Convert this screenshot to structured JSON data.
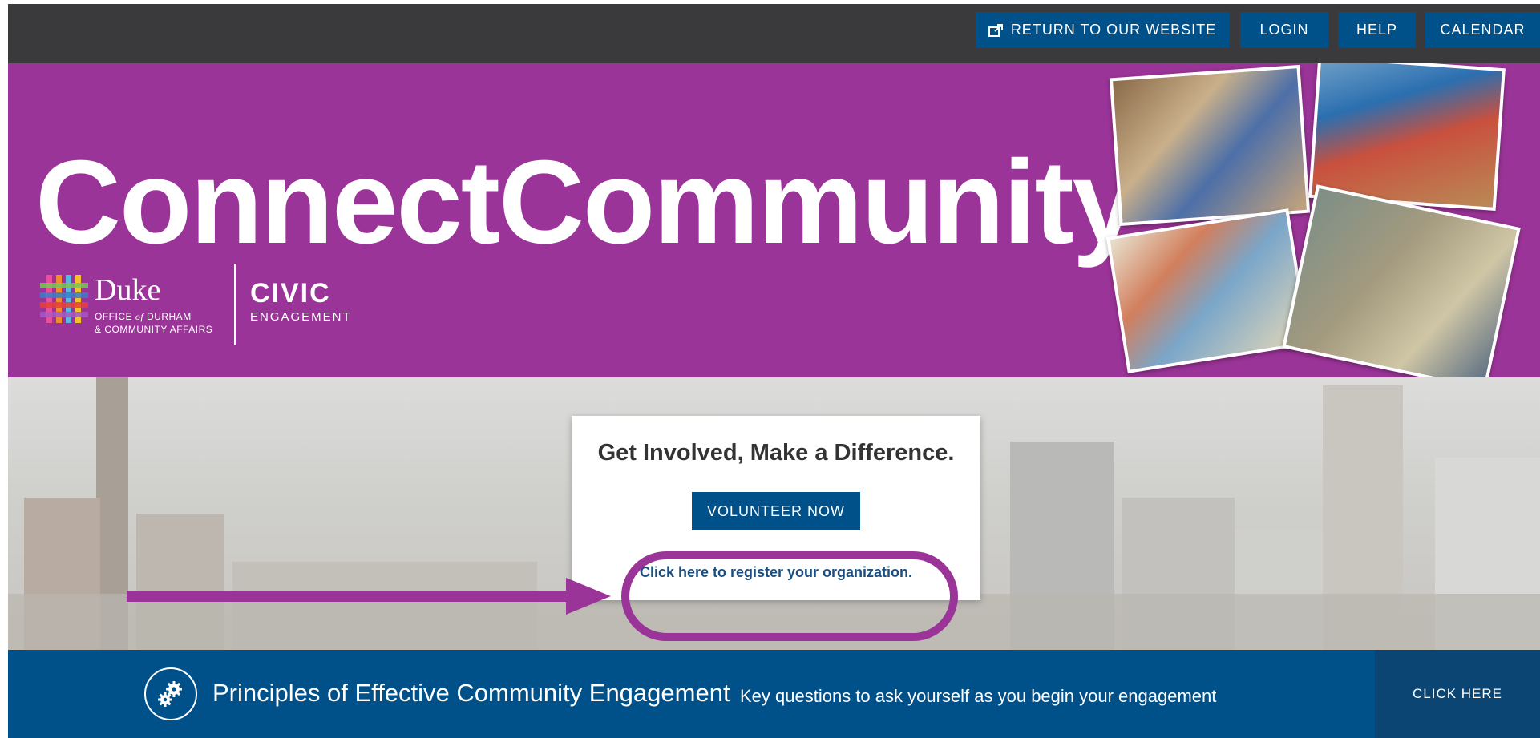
{
  "topnav": {
    "return_label": "RETURN TO OUR WEBSITE",
    "login_label": "LOGIN",
    "help_label": "HELP",
    "calendar_label": "CALENDAR",
    "return_icon": "external-link-icon"
  },
  "header": {
    "title": "ConnectCommunity",
    "logo": {
      "duke": "Duke",
      "office_line1_a": "OFFICE ",
      "office_line1_of": "of",
      "office_line1_b": " DURHAM",
      "office_line2": "& COMMUNITY AFFAIRS",
      "civic": "CIVIC",
      "engagement": "ENGAGEMENT"
    }
  },
  "hero": {
    "card_title": "Get Involved, Make a Difference.",
    "volunteer_label": "VOLUNTEER NOW",
    "register_link": "Click here to register your organization.",
    "annotation_color": "#9b3498"
  },
  "banner": {
    "title": "Principles of Effective Community Engagement",
    "subtitle": "Key questions to ask yourself as you begin your engagement",
    "cta_label": "CLICK HERE",
    "icon": "gears-icon"
  },
  "colors": {
    "topbar": "#3a3a3d",
    "brand_purple": "#9b3498",
    "brand_blue": "#00508a"
  }
}
